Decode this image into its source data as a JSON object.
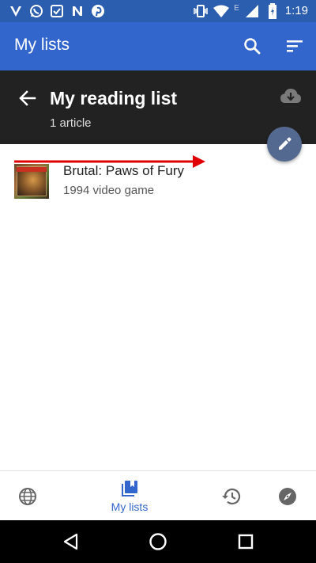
{
  "status_bar": {
    "time": "1:19",
    "network_badge": "E",
    "left_icons": [
      "v-app-icon",
      "whatsapp-icon",
      "message-app-icon",
      "n-app-icon",
      "pinterest-icon"
    ],
    "right_icons": [
      "vibrate-icon",
      "wifi-icon",
      "signal-icon",
      "battery-charging-icon"
    ]
  },
  "app_bar": {
    "title": "My lists",
    "icons": [
      "search-icon",
      "sort-icon"
    ]
  },
  "list_header": {
    "title": "My reading list",
    "subtitle": "1 article",
    "icons": [
      "back-arrow-icon",
      "cloud-download-icon"
    ]
  },
  "fab": {
    "icon": "edit-pencil-icon"
  },
  "articles": [
    {
      "title": "Brutal: Paws of Fury",
      "description": "1994 video game",
      "thumbnail": "game-cover-art"
    }
  ],
  "annotation": {
    "type": "swipe-right-arrow",
    "color": "#e00000"
  },
  "bottom_nav": {
    "items": [
      {
        "name": "explore",
        "icon": "globe-icon",
        "label": ""
      },
      {
        "name": "my-lists",
        "icon": "bookmark-lists-icon",
        "label": "My lists",
        "active": true
      },
      {
        "name": "history",
        "icon": "history-icon",
        "label": ""
      },
      {
        "name": "nearby",
        "icon": "compass-icon",
        "label": ""
      }
    ]
  },
  "colors": {
    "status_bar": "#2b5eae",
    "app_bar": "#3366cc",
    "list_header": "#222222",
    "accent": "#3366cc",
    "fab": "#54698f",
    "system_nav": "#000000"
  },
  "system_nav": {
    "buttons": [
      "back-triangle-icon",
      "home-circle-icon",
      "recents-square-icon"
    ]
  }
}
